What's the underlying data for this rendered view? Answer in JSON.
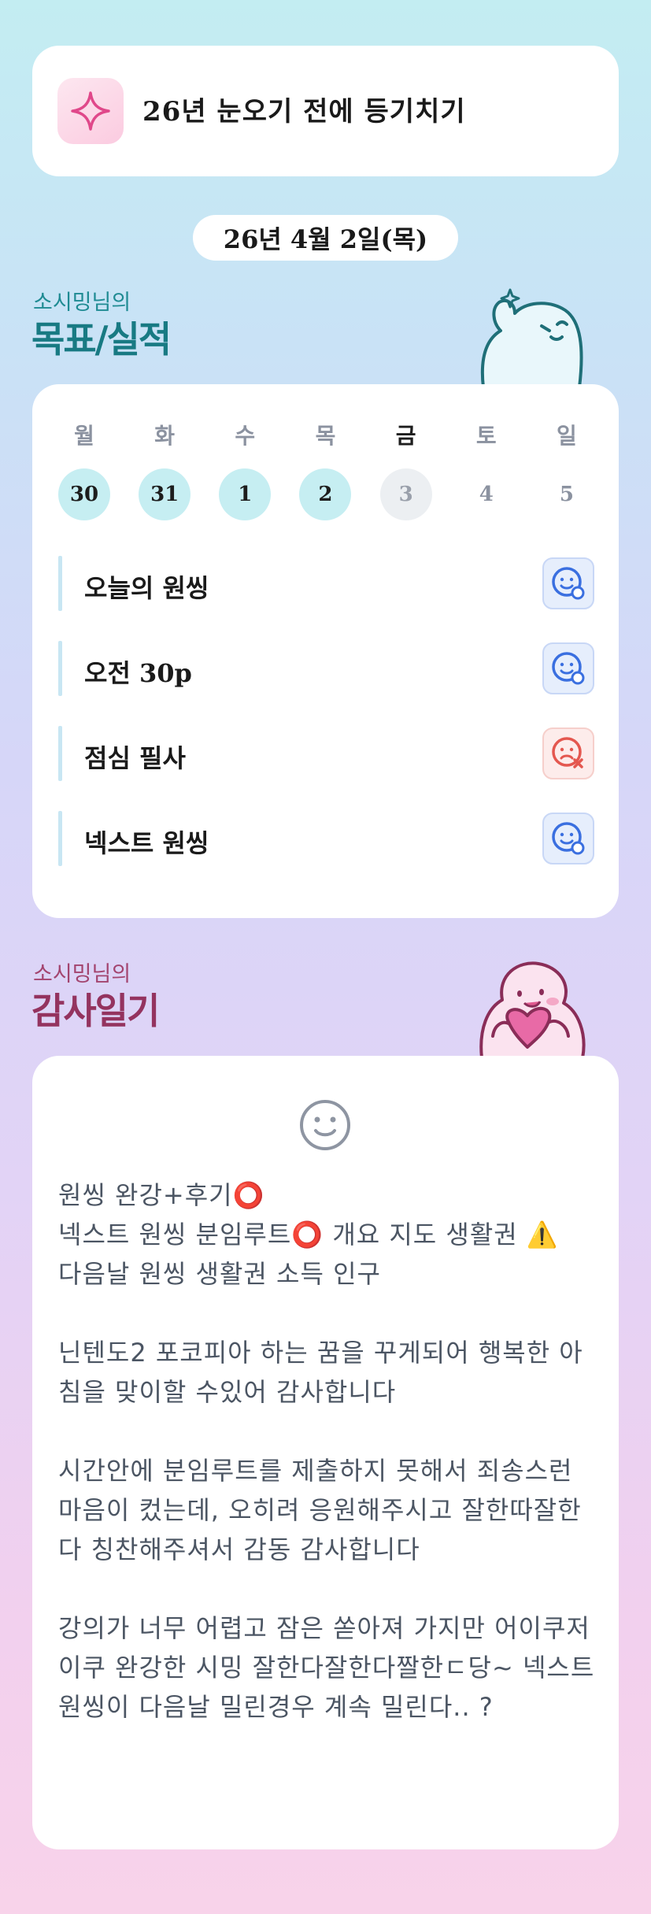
{
  "banner": {
    "icon": "sparkle-icon",
    "title": "26년 눈오기 전에 등기치기"
  },
  "date": "26년 4월 2일(목)",
  "goals_section": {
    "subtitle": "소시밍님의",
    "title": "목표/실적"
  },
  "week": {
    "days": [
      {
        "weekday": "월",
        "date": "30",
        "state": "done"
      },
      {
        "weekday": "화",
        "date": "31",
        "state": "done"
      },
      {
        "weekday": "수",
        "date": "1",
        "state": "done"
      },
      {
        "weekday": "목",
        "date": "2",
        "state": "done"
      },
      {
        "weekday": "금",
        "date": "3",
        "state": "today"
      },
      {
        "weekday": "토",
        "date": "4",
        "state": "future"
      },
      {
        "weekday": "일",
        "date": "5",
        "state": "future"
      }
    ]
  },
  "goals": [
    {
      "label": "오늘의 원씽",
      "status": "ok",
      "icon": "smile-check-icon"
    },
    {
      "label": "오전 30p",
      "status": "ok",
      "icon": "smile-check-icon"
    },
    {
      "label": "점심 필사",
      "status": "fail",
      "icon": "sad-x-icon"
    },
    {
      "label": "넥스트 원씽",
      "status": "ok",
      "icon": "smile-check-icon"
    }
  ],
  "journal_section": {
    "subtitle": "소시밍님의",
    "title": "감사일기"
  },
  "journal": {
    "icon": "smiley-icon",
    "text": "원씽 완강+후기⭕\n넥스트 원씽 분임루트⭕ 개요 지도 생활권 ⚠️\n다음날 원씽 생활권 소득 인구\n\n닌텐도2 포코피아 하는 꿈을 꾸게되어 행복한 아침을 맞이할 수있어 감사합니다\n\n시간안에 분임루트를 제출하지 못해서 죄송스런 마음이 컸는데, 오히려 응원해주시고 잘한따잘한다 칭찬해주셔서 감동 감사합니다\n\n강의가 너무 어렵고 잠은 쏟아져 가지만 어이쿠저이쿠 완강한 시밍 잘한다잘한다짤한ㄷ당~ 넥스트 원씽이 다음날 밀린경우 계속 밀린다.. ?"
  },
  "colors": {
    "teal": "#1f8b93",
    "plum": "#a3446f",
    "done_day": "#c6eef2",
    "ok_icon": "#3a6fe0",
    "fail_icon": "#e4574f"
  }
}
